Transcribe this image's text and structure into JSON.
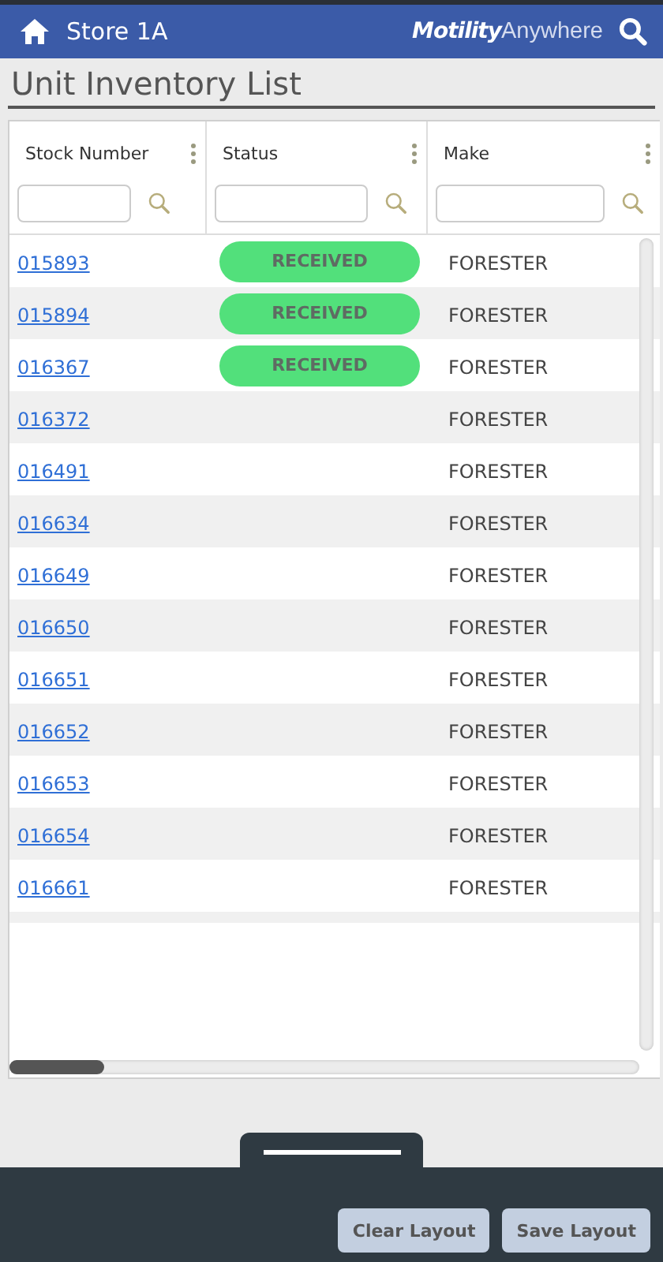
{
  "header": {
    "store": "Store 1A",
    "brand_bold": "Motility",
    "brand_light": "Anywhere"
  },
  "page_title": "Unit Inventory List",
  "table": {
    "columns": [
      {
        "label": "Stock Number"
      },
      {
        "label": "Status"
      },
      {
        "label": "Make"
      }
    ],
    "rows": [
      {
        "stock_number": "015893",
        "status": "RECEIVED",
        "make": "FORESTER"
      },
      {
        "stock_number": "015894",
        "status": "RECEIVED",
        "make": "FORESTER"
      },
      {
        "stock_number": "016367",
        "status": "RECEIVED",
        "make": "FORESTER"
      },
      {
        "stock_number": "016372",
        "make": "FORESTER"
      },
      {
        "stock_number": "016491",
        "make": "FORESTER"
      },
      {
        "stock_number": "016634",
        "make": "FORESTER"
      },
      {
        "stock_number": "016649",
        "make": "FORESTER"
      },
      {
        "stock_number": "016650",
        "make": "FORESTER"
      },
      {
        "stock_number": "016651",
        "make": "FORESTER"
      },
      {
        "stock_number": "016652",
        "make": "FORESTER"
      },
      {
        "stock_number": "016653",
        "make": "FORESTER"
      },
      {
        "stock_number": "016654",
        "make": "FORESTER"
      },
      {
        "stock_number": "016661",
        "make": "FORESTER"
      }
    ]
  },
  "footer": {
    "buttons": [
      "Clear Layout",
      "Save Layout"
    ]
  }
}
